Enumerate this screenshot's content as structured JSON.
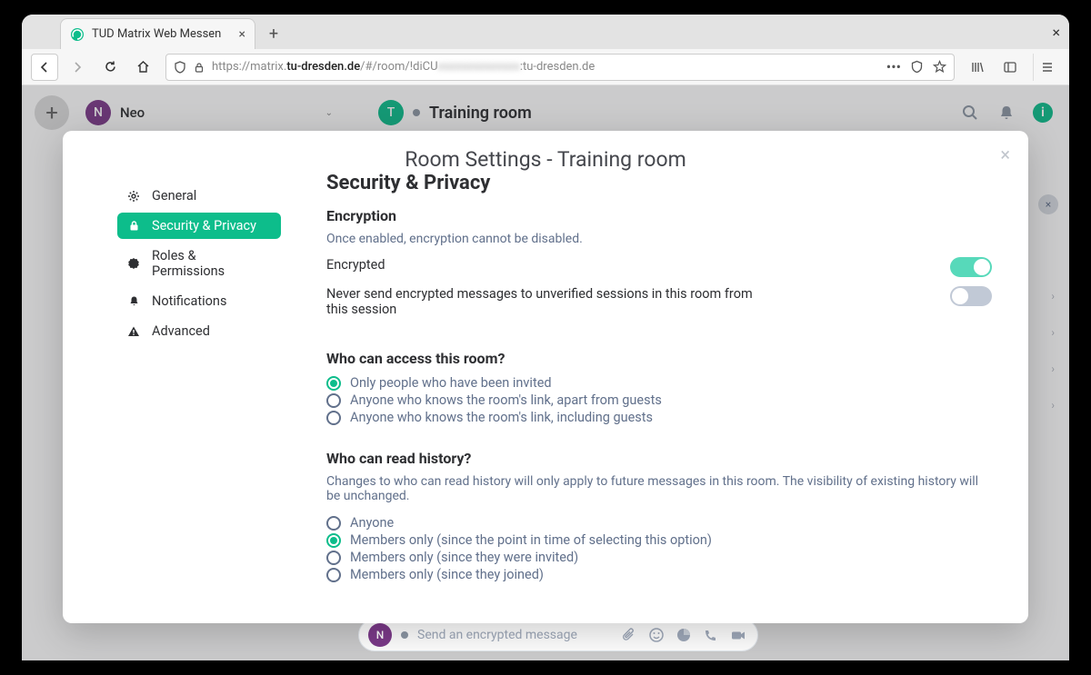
{
  "browser": {
    "tab_title": "TUD Matrix Web Messen",
    "url_prefix": "https://matrix.",
    "url_host": "tu-dresden.de",
    "url_path_1": "/#/room/!diCU",
    "url_path_2": ":tu-dresden.de"
  },
  "app": {
    "user_initial": "N",
    "user_name": "Neo",
    "room_initial": "T",
    "room_name": "Training  room",
    "composer_placeholder": "Send an encrypted message",
    "composer_initial": "N"
  },
  "modal": {
    "title": "Room Settings - Training  room",
    "nav": {
      "general": "General",
      "security": "Security & Privacy",
      "roles": "Roles & Permissions",
      "notifications": "Notifications",
      "advanced": "Advanced"
    },
    "content": {
      "heading": "Security & Privacy",
      "encryption_title": "Encryption",
      "encryption_note": "Once enabled, encryption cannot be disabled.",
      "toggle_encrypted": "Encrypted",
      "toggle_never_send": "Never send encrypted messages to unverified sessions in this room from this session",
      "access_title": "Who can access this room?",
      "access_opts": {
        "invited": "Only people who have been invited",
        "link_no_guests": "Anyone who knows the room's link, apart from guests",
        "link_guests": "Anyone who knows the room's link, including guests"
      },
      "history_title": "Who can read history?",
      "history_note": "Changes to who can read history will only apply to future messages in this room. The visibility of existing history will be unchanged.",
      "history_opts": {
        "anyone": "Anyone",
        "since_selected": "Members only (since the point in time of selecting this option)",
        "since_invited": "Members only (since they were invited)",
        "since_joined": "Members only (since they joined)"
      }
    }
  }
}
